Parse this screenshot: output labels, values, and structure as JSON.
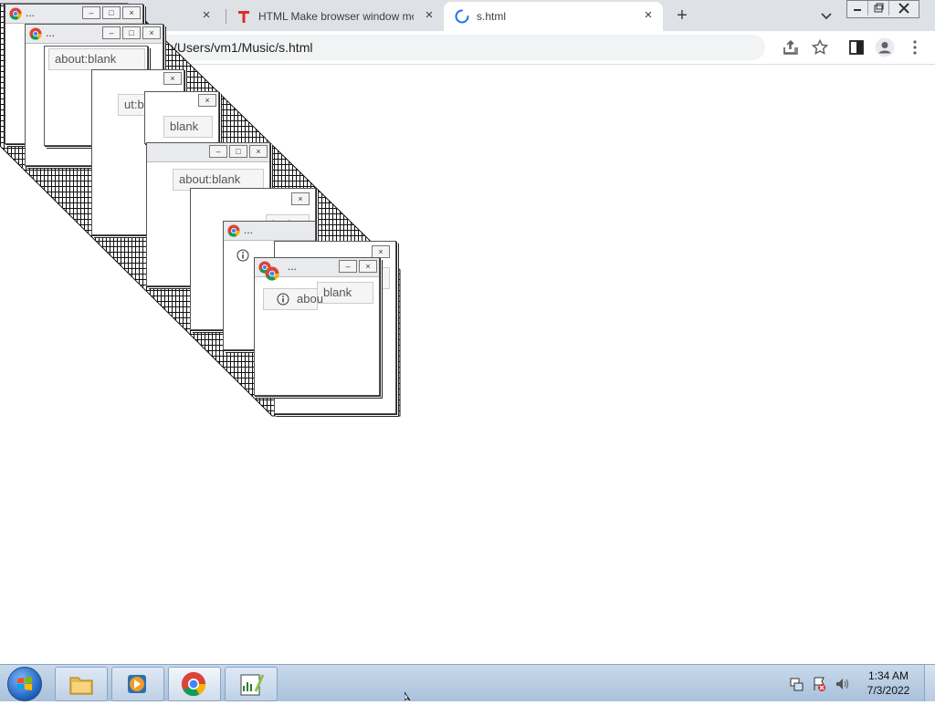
{
  "tabs": [
    {
      "label": "...",
      "favicon": "chrome-icon",
      "close": "×"
    },
    {
      "label": "HTML Make browser window mo",
      "favicon": "T-icon",
      "close": "×"
    },
    {
      "label": "s.html",
      "favicon": "loading-spinner-icon",
      "close": "×"
    }
  ],
  "newtab_label": "+",
  "address": {
    "url": "C:/Users/vm1/Music/s.html"
  },
  "popups": [
    {
      "addr": "about:blank",
      "dots": "..."
    },
    {
      "addr": "about:blank"
    },
    {
      "addr": "ut:blank"
    },
    {
      "addr": "blank"
    },
    {
      "addr": "about:blank"
    },
    {
      "addr": "lank"
    },
    {
      "addr": "...",
      "dots": "..."
    },
    {
      "addr": "blank"
    },
    {
      "addr": "blank"
    },
    {
      "addr": "abou",
      "dots": "..."
    }
  ],
  "taskbar": {
    "items": [
      "file-explorer-icon",
      "media-player-icon",
      "chrome-icon",
      "notepad-plus-icon"
    ],
    "time": "1:34 AM",
    "date": "7/3/2022"
  },
  "colors": {
    "tabstrip": "#dee1e6",
    "taskbar": "#b9cde4",
    "accent": "#1a73e8"
  }
}
